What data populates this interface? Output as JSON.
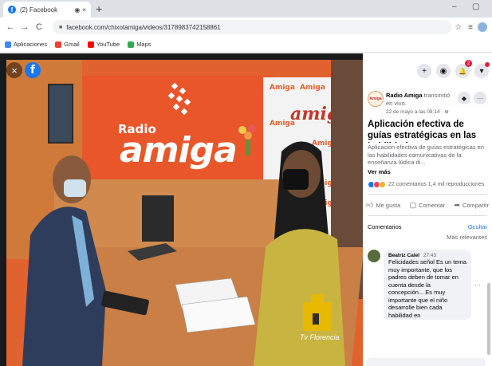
{
  "browser": {
    "tab_title": "(2) Facebook",
    "tab_badge": "f",
    "tab_mute": "◉",
    "tab_close": "×",
    "new_tab": "+",
    "minimize": "–",
    "maximize": "▢",
    "url": "facebook.com/chixotamiga/videos/3178983742158861",
    "bookmarks": [
      {
        "label": "Aplicaciones",
        "color": "#4285f4"
      },
      {
        "label": "Gmail",
        "color": "#ea4335"
      },
      {
        "label": "YouTube",
        "color": "#ff0000"
      },
      {
        "label": "Maps",
        "color": "#34a853"
      }
    ]
  },
  "video": {
    "close": "×",
    "fb": "f",
    "studio_radio": "Radio",
    "studio_amiga": "amiga",
    "banner_word": "Amiga",
    "banner_big": "amiga",
    "tv_logo_text": "Tv Florencia"
  },
  "panel": {
    "top_buttons": [
      "+",
      "◉",
      "🔔",
      "▾"
    ],
    "notif_count": "2",
    "page_avatar_text": "Amiga",
    "page_name": "Radio Amiga",
    "page_action": "transmitió en vivo.",
    "post_date": "22 de mayo a las 08:14 · ⊕",
    "post_title": "Aplicación efectiva de guías estratégicas en las habilidades...",
    "post_desc": "Aplicación efectiva de guías estratégicas en las habilidades comunicativas de la enseñanza lúdica di...",
    "see_more": "Ver más",
    "stats": "22 comentarios  1,4 mil reproducciones",
    "like": "Me gusta",
    "comment": "Comentar",
    "share": "Compartir",
    "comments_label": "Comentarios",
    "hide": "Ocultar",
    "sort": "Más relevantes",
    "comment_item": {
      "name": "Beatriz Calel",
      "time": "27:43",
      "text": "Felicidades señol Es un tema muy importante, que los padres deben de tomar en cuenta desde la concepción... Es muy importante que el niño desarrolle bien cada habilidad en"
    }
  }
}
